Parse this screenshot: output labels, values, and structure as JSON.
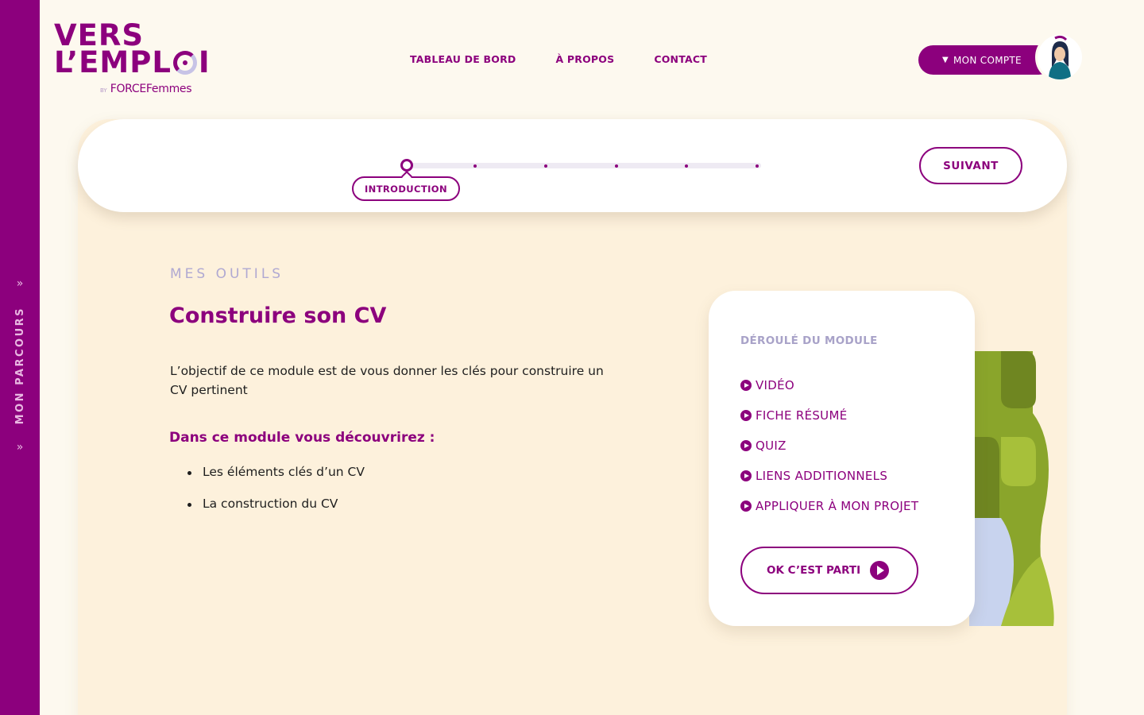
{
  "colors": {
    "brand": "#8c007d",
    "background": "#fdf9ef",
    "card": "#fdf1dc",
    "muted": "#b0a9d2"
  },
  "sidebar": {
    "label": "MON PARCOURS",
    "icon": "double-chevron-icon"
  },
  "logo": {
    "line1": "VERS",
    "line2a": "L’EMPL",
    "line2b": "I",
    "by": "BY",
    "brand": "FORCEFemmes"
  },
  "nav": {
    "dashboard": "TABLEAU DE BORD",
    "about": "À PROPOS",
    "contact": "CONTACT"
  },
  "account": {
    "label": "MON COMPTE",
    "icon": "chevron-down-icon"
  },
  "progress": {
    "current_label": "INTRODUCTION",
    "current_step": 1,
    "total_steps": 6,
    "next_label": "SUIVANT"
  },
  "content": {
    "eyebrow": "MES OUTILS",
    "title": "Construire son CV",
    "intro": "L’objectif de ce module est de vous donner les clés pour construire un CV pertinent",
    "subtitle": "Dans ce module vous découvrirez :",
    "bullets": [
      "Les éléments clés d’un CV",
      "La construction du CV"
    ]
  },
  "module": {
    "heading": "DÉROULÉ DU MODULE",
    "items": [
      "VIDÉO",
      "FICHE RÉSUMÉ",
      "QUIZ",
      "LIENS ADDITIONNELS",
      "APPLIQUER À MON PROJET"
    ],
    "cta": "OK C’EST PARTI"
  }
}
